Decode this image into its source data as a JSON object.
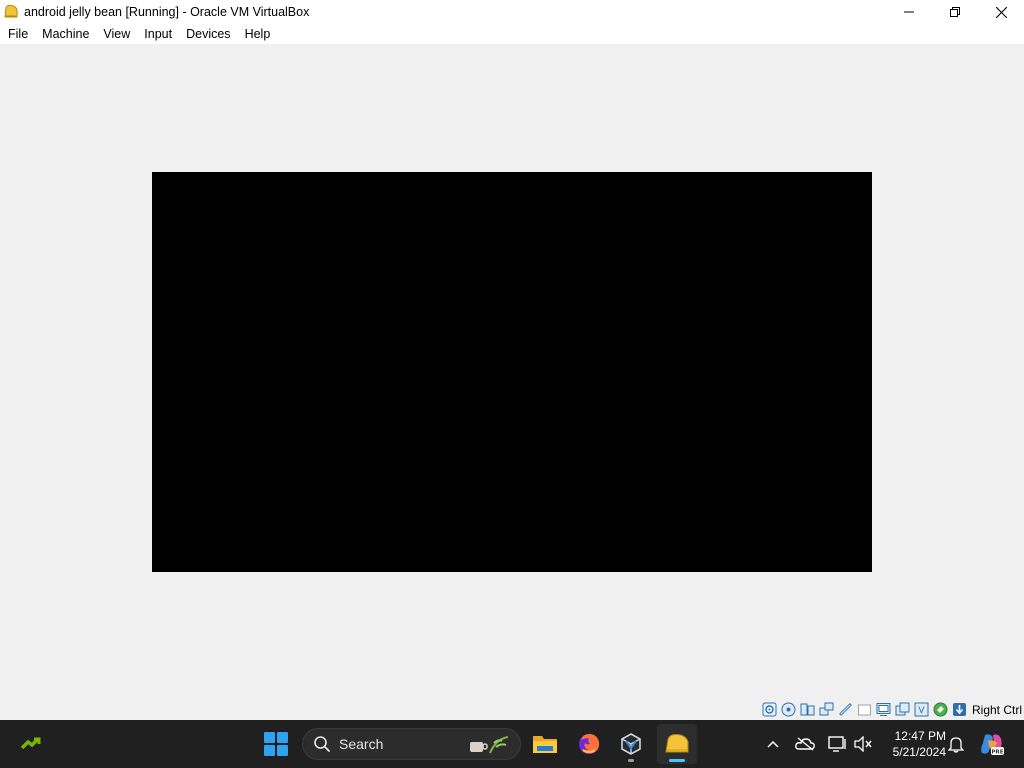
{
  "window": {
    "title": "android jelly bean [Running] - Oracle VM VirtualBox",
    "controls": {
      "minimize_icon": "minimize-icon",
      "maximize_icon": "maximize-icon",
      "close_icon": "close-icon"
    }
  },
  "menubar": {
    "items": [
      "File",
      "Machine",
      "View",
      "Input",
      "Devices",
      "Help"
    ]
  },
  "vm": {
    "screen_color": "#000000",
    "background_color": "#f0f0f0"
  },
  "statusbar": {
    "icons": [
      "hard-disk-icon",
      "optical-drive-icon",
      "audio-icon",
      "network-icon",
      "usb-icon",
      "shared-folders-icon",
      "display-icon",
      "recording-icon",
      "virtualization-icon",
      "mouse-integration-icon",
      "keyboard-capture-icon"
    ],
    "host_key": "Right Ctrl"
  },
  "taskbar": {
    "search_label": "Search",
    "apps": [
      "nvidia-icon",
      "start-icon",
      "file-explorer-icon",
      "firefox-icon",
      "virtualbox-icon",
      "vm-window-icon"
    ],
    "tray": [
      "chevron-up-icon",
      "onedrive-icon",
      "display-network-icon",
      "speaker-muted-icon",
      "notification-bell-icon",
      "copilot-icon"
    ],
    "clock": {
      "time": "12:47 PM",
      "date": "5/21/2024"
    },
    "copilot_badge": "PRE"
  },
  "colors": {
    "taskbar_bg": "#202020",
    "accent": "#4cc2ff",
    "start_blue": "#2ea3f2"
  }
}
